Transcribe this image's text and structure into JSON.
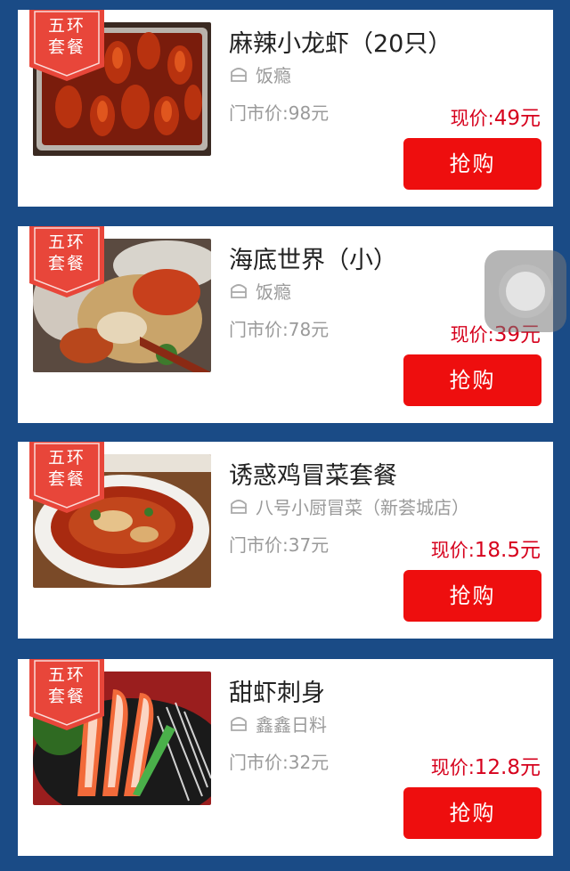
{
  "colors": {
    "background": "#1a4b86",
    "price_red": "#d6001c",
    "button_red": "#ee0e0e",
    "ribbon_red": "#e8463a"
  },
  "icons": {
    "shop": "shop-icon",
    "assistive_touch": "assistive-touch-icon"
  },
  "deals": [
    {
      "ribbon": [
        "五环",
        "套餐"
      ],
      "title": "麻辣小龙虾（20只）",
      "shop": "饭瘾",
      "original_price": "门市价:98元",
      "current_label": "现价:",
      "current_value": "49元",
      "button": "抢购",
      "image": "crayfish-image"
    },
    {
      "ribbon": [
        "五环",
        "套餐"
      ],
      "title": "海底世界（小）",
      "shop": "饭瘾",
      "original_price": "门市价:78元",
      "current_label": "现价:",
      "current_value": "39元",
      "button": "抢购",
      "image": "seafood-platter-image"
    },
    {
      "ribbon": [
        "五环",
        "套餐"
      ],
      "title": "诱惑鸡冒菜套餐",
      "shop": "八号小厨冒菜（新荟城店）",
      "original_price": "门市价:37元",
      "current_label": "现价:",
      "current_value": "18.5元",
      "button": "抢购",
      "image": "chicken-maocai-image"
    },
    {
      "ribbon": [
        "五环",
        "套餐"
      ],
      "title": "甜虾刺身",
      "shop": "鑫鑫日料",
      "original_price": "门市价:32元",
      "current_label": "现价:",
      "current_value": "12.8元",
      "button": "抢购",
      "image": "sweet-shrimp-sashimi-image"
    }
  ]
}
